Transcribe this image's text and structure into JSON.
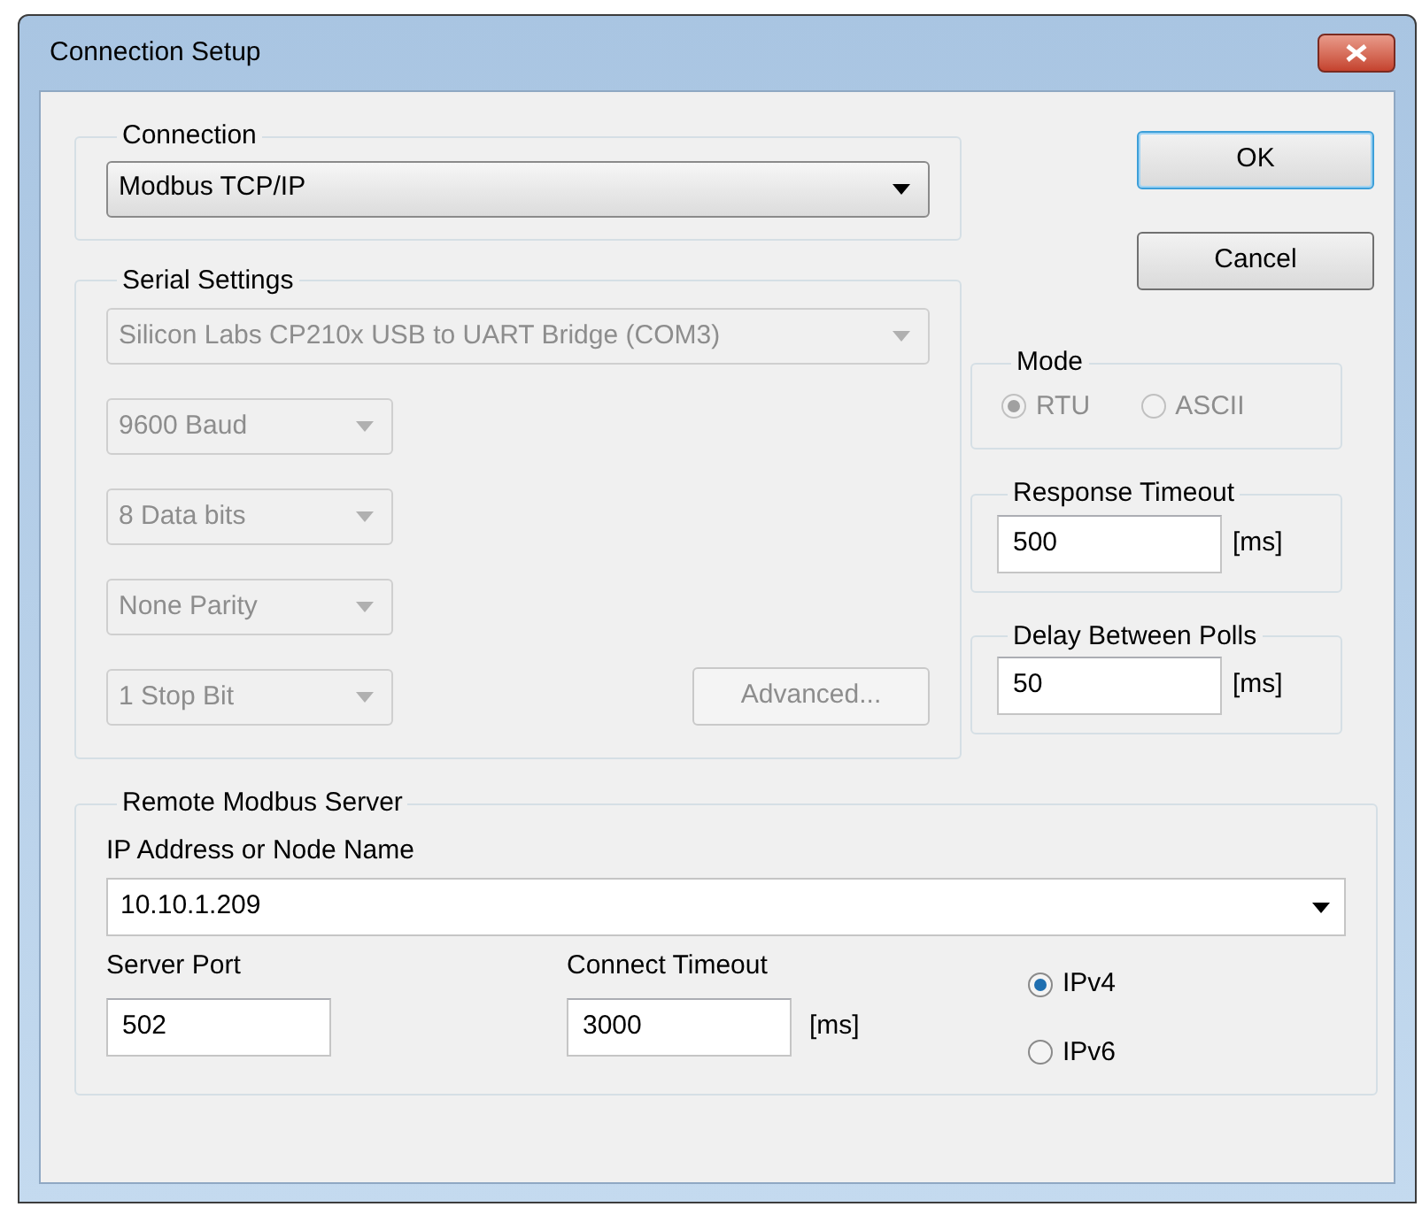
{
  "window": {
    "title": "Connection Setup"
  },
  "connection": {
    "label": "Connection",
    "value": "Modbus TCP/IP"
  },
  "serial_settings": {
    "label": "Serial Settings",
    "disabled": true,
    "port": "Silicon Labs CP210x USB to UART Bridge (COM3)",
    "selects": [
      "9600 Baud",
      "8 Data bits",
      "None Parity",
      "1 Stop Bit"
    ],
    "advanced_button": "Advanced..."
  },
  "buttons": [
    {
      "label": "OK",
      "default": true
    },
    {
      "label": "Cancel",
      "default": false
    }
  ],
  "mode": {
    "label": "Mode",
    "disabled": true,
    "options": [
      {
        "label": "RTU",
        "selected": true
      },
      {
        "label": "ASCII",
        "selected": false
      }
    ]
  },
  "timeouts": [
    {
      "label": "Response Timeout",
      "value": "500",
      "unit": "[ms]"
    },
    {
      "label": "Delay Between Polls",
      "value": "50",
      "unit": "[ms]"
    }
  ],
  "remote_server": {
    "label": "Remote Modbus Server",
    "ip_label": "IP Address or Node Name",
    "ip_value": "10.10.1.209",
    "port_label": "Server Port",
    "port_value": "502",
    "timeout_label": "Connect Timeout",
    "timeout_value": "3000",
    "timeout_unit": "[ms]",
    "ip_versions": [
      {
        "label": "IPv4",
        "selected": true
      },
      {
        "label": "IPv6",
        "selected": false
      }
    ]
  }
}
